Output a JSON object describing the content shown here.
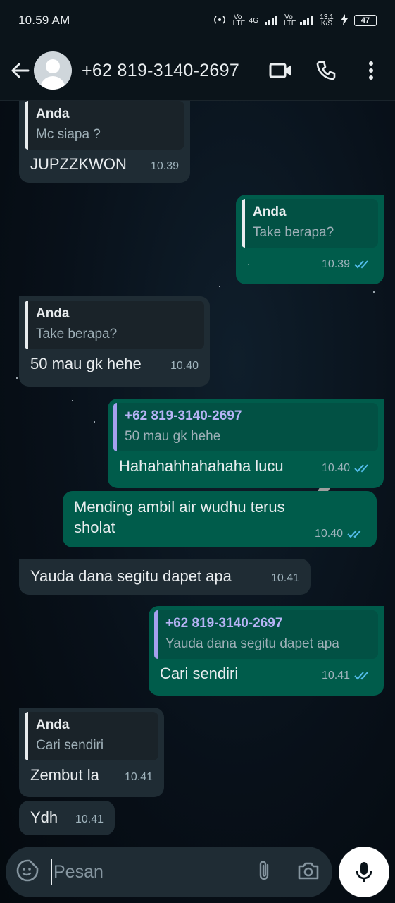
{
  "status_bar": {
    "time": "10.59 AM",
    "vo_lte_1": "Vo LTE",
    "network_4g": "4G",
    "vo_lte_2": "Vo LTE",
    "speed": "13,1 K/S",
    "battery": "47"
  },
  "header": {
    "contact_name": "+62 819-3140-2697",
    "icons": [
      "back-arrow-icon",
      "avatar",
      "video-call-icon",
      "phone-call-icon",
      "more-options-icon"
    ]
  },
  "messages": [
    {
      "dir": "in",
      "quote_name": "Anda",
      "quote_text": "Mc siapa ?",
      "text": "JUPZZKWON",
      "time": "10.39"
    },
    {
      "dir": "out",
      "quote_name": "Anda",
      "quote_text": "Take berapa?",
      "text": ".",
      "time": "10.39",
      "read": true
    },
    {
      "dir": "in",
      "quote_name": "Anda",
      "quote_text": "Take berapa?",
      "text": "50 mau gk hehe",
      "time": "10.40"
    },
    {
      "dir": "out",
      "quote_name": "+62 819-3140-2697",
      "quote_text": "50 mau gk hehe",
      "text": "Hahahahhahahaha lucu",
      "time": "10.40",
      "read": true
    },
    {
      "dir": "out",
      "text": "Mending ambil air wudhu terus sholat",
      "time": "10.40",
      "read": true
    },
    {
      "dir": "in",
      "text": "Yauda dana segitu dapet apa",
      "time": "10.41"
    },
    {
      "dir": "out",
      "quote_name": "+62 819-3140-2697",
      "quote_text": "Yauda dana segitu dapet apa",
      "text": "Cari sendiri",
      "time": "10.41",
      "read": true
    },
    {
      "dir": "in",
      "quote_name": "Anda",
      "quote_text": "Cari sendiri",
      "text": "Zembut la",
      "time": "10.41"
    },
    {
      "dir": "in",
      "text": "Ydh",
      "time": "10.41"
    }
  ],
  "composer": {
    "placeholder": "Pesan"
  },
  "colors": {
    "incoming_bubble": "#1f2c34",
    "outgoing_bubble": "#005c4b",
    "read_ticks": "#53bdeb",
    "header_bg": "#0b141a"
  }
}
